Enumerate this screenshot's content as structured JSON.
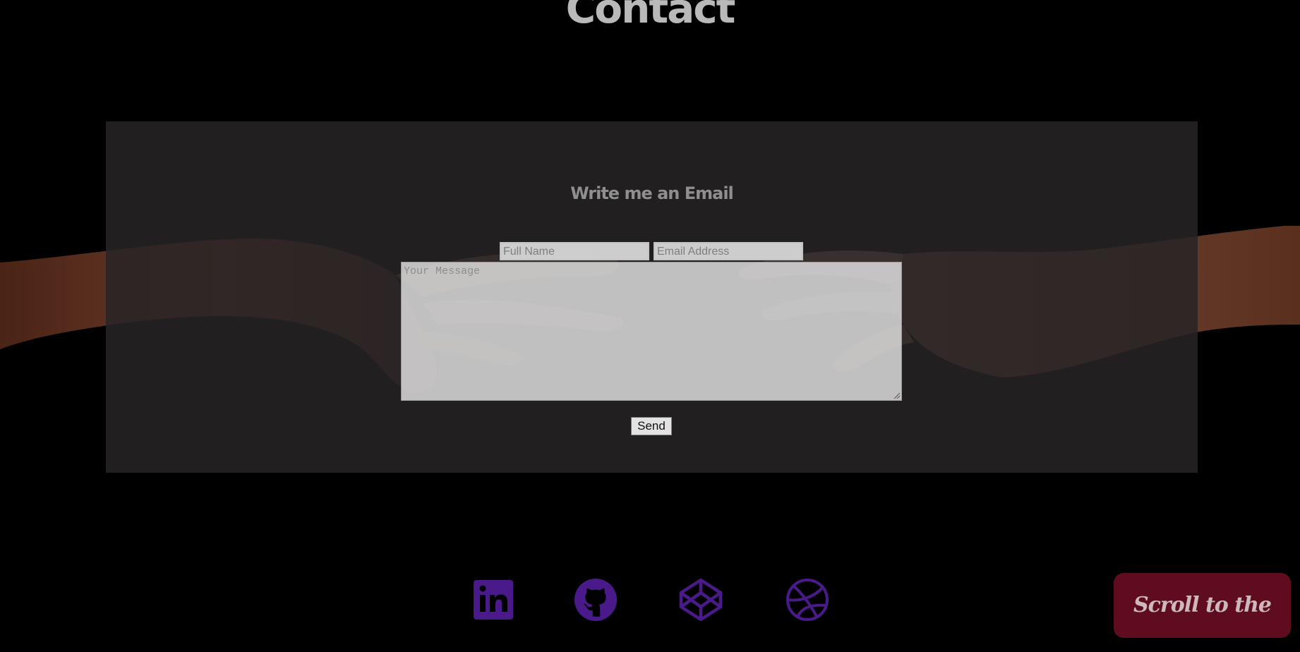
{
  "header": {
    "title": "Contact"
  },
  "contact_form": {
    "heading": "Write me an Email",
    "name_placeholder": "Full Name",
    "email_placeholder": "Email Address",
    "message_placeholder": "Your Message",
    "send_label": "Send"
  },
  "social_links": [
    {
      "name": "LinkedIn",
      "icon": "linkedin-icon"
    },
    {
      "name": "GitHub",
      "icon": "github-icon"
    },
    {
      "name": "CodePen",
      "icon": "codepen-icon"
    },
    {
      "name": "Dribbble",
      "icon": "dribbble-icon"
    }
  ],
  "scroll_top": {
    "label": "Scroll to the top"
  },
  "colors": {
    "background": "#000000",
    "panel": "#262425",
    "accent_purple": "#4b1a8a",
    "scroll_button": "#5f0d1e"
  }
}
